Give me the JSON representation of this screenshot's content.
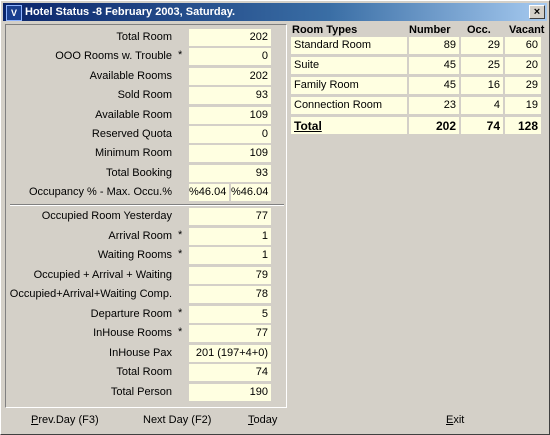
{
  "window": {
    "title": "Hotel Status -8 February 2003, Saturday.",
    "close_glyph": "×",
    "icon_glyph": "V"
  },
  "left_top": [
    {
      "label": "Total Room",
      "value": "202",
      "star": false
    },
    {
      "label": "OOO Rooms w. Trouble",
      "value": "0",
      "star": true
    },
    {
      "label": "Available Rooms",
      "value": "202",
      "star": false
    },
    {
      "label": "Sold Room",
      "value": "93",
      "star": false
    },
    {
      "label": "Available Room",
      "value": "109",
      "star": false
    },
    {
      "label": "Reserved Quota",
      "value": "0",
      "star": false
    },
    {
      "label": "Minimum Room",
      "value": "109",
      "star": false
    },
    {
      "label": "Total Booking",
      "value": "93",
      "star": false
    }
  ],
  "occupancy": {
    "label": "Occupancy % - Max. Occu.%",
    "value1": "%46.04",
    "value2": "%46.04"
  },
  "left_bottom": [
    {
      "label": "Occupied Room Yesterday",
      "value": "77",
      "star": false
    },
    {
      "label": "Arrival Room",
      "value": "1",
      "star": true
    },
    {
      "label": "Waiting Rooms",
      "value": "1",
      "star": true
    },
    {
      "label": "Occupied + Arrival + Waiting",
      "value": "79",
      "star": false
    },
    {
      "label": "Occupied+Arrival+Waiting Comp.",
      "value": "78",
      "star": false
    },
    {
      "label": "Departure Room",
      "value": "5",
      "star": true
    },
    {
      "label": "InHouse Rooms",
      "value": "77",
      "star": true
    },
    {
      "label": "InHouse Pax",
      "value": "201 (197+4+0)",
      "star": false
    },
    {
      "label": "Total Room",
      "value": "74",
      "star": false
    },
    {
      "label": "Total Person",
      "value": "190",
      "star": false
    }
  ],
  "star_glyph": "*",
  "room_types": {
    "headers": {
      "type": "Room Types",
      "number": "Number",
      "occ": "Occ.",
      "vacant": "Vacant"
    },
    "rows": [
      {
        "type": "Standard Room",
        "number": "89",
        "occ": "29",
        "vacant": "60"
      },
      {
        "type": "Suite",
        "number": "45",
        "occ": "25",
        "vacant": "20"
      },
      {
        "type": "Family Room",
        "number": "45",
        "occ": "16",
        "vacant": "29"
      },
      {
        "type": "Connection Room",
        "number": "23",
        "occ": "4",
        "vacant": "19"
      }
    ],
    "total": {
      "type": "Total",
      "number": "202",
      "occ": "74",
      "vacant": "128"
    }
  },
  "buttons": {
    "prev_day": "Prev.Day (F3)",
    "next_day": "Next Day (F2)",
    "today": "Today",
    "exit": "Exit"
  }
}
